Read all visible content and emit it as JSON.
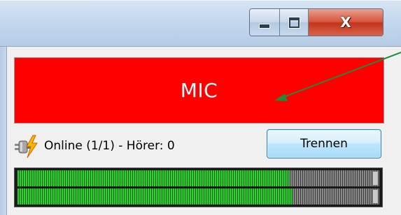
{
  "window": {
    "caption_buttons": [
      {
        "name": "minimize",
        "icon": "minimize-icon"
      },
      {
        "name": "maximize",
        "icon": "maximize-icon"
      },
      {
        "name": "close",
        "icon": "close-icon",
        "glyph": "X"
      }
    ]
  },
  "mic_panel": {
    "label": "MIC",
    "background": "#ff0000"
  },
  "status": {
    "icon": "plug-lightning-icon",
    "text": "Online (1/1) - Hörer: 0"
  },
  "disconnect_button": {
    "label": "Trennen"
  },
  "level_meters": [
    {
      "channel": "left",
      "level": 0.75
    },
    {
      "channel": "right",
      "level": 0.76
    }
  ],
  "annotation": {
    "type": "arrow",
    "color": "#1e8a3a"
  }
}
